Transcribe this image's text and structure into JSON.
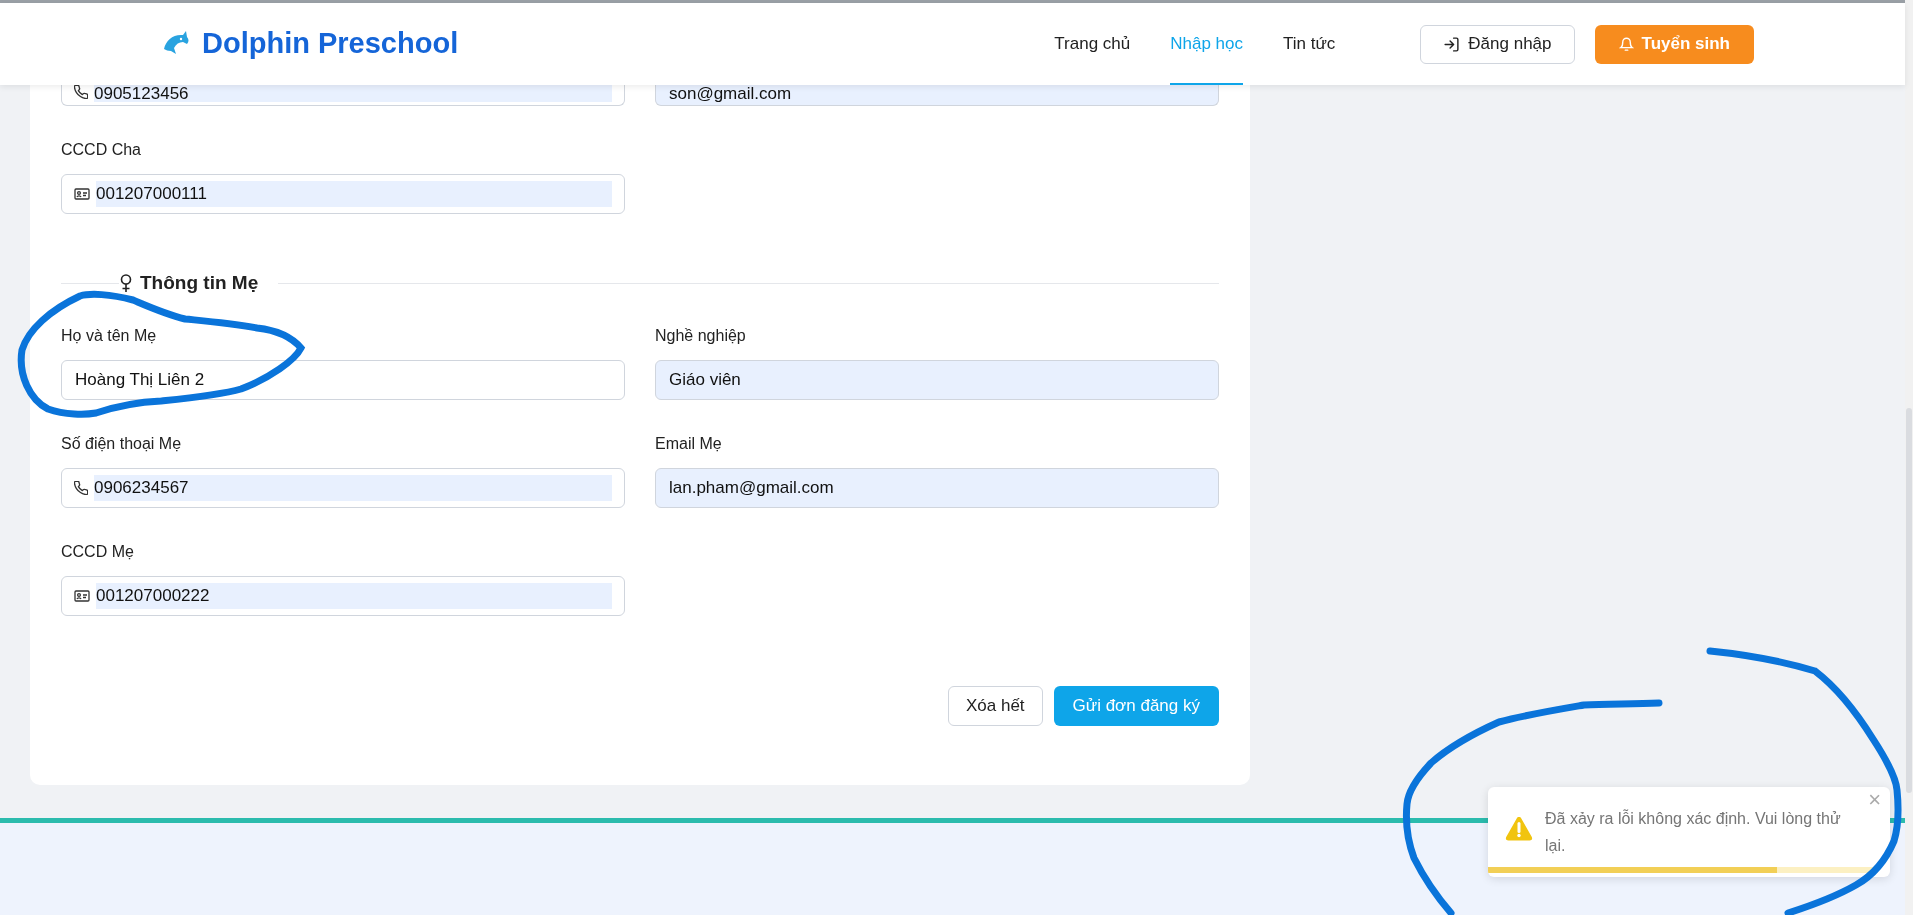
{
  "header": {
    "brand": "Dolphin Preschool",
    "nav": [
      {
        "label": "Trang chủ",
        "selected": false
      },
      {
        "label": "Nhập học",
        "selected": true
      },
      {
        "label": "Tin tức",
        "selected": false
      }
    ],
    "login_button": "Đăng nhập",
    "cta_button": "Tuyển sinh"
  },
  "father_rows": [
    [
      {
        "kind": "phone",
        "value": "0905123456",
        "autofilled": true
      },
      {
        "kind": "text",
        "value": "son@gmail.com",
        "autofilled": true
      }
    ],
    [
      {
        "label": "CCCD Cha",
        "kind": "id",
        "value": "001207000111",
        "autofilled": true
      }
    ]
  ],
  "mother_section": {
    "title": "Thông tin Mẹ",
    "rows": [
      [
        {
          "label": "Họ và tên Mẹ",
          "kind": "text",
          "value": "Hoàng Thị Liên 2",
          "autofilled": false
        },
        {
          "label": "Nghề nghiệp",
          "kind": "text",
          "value": "Giáo viên",
          "autofilled": true
        }
      ],
      [
        {
          "label": "Số điện thoại Mẹ",
          "kind": "phone",
          "value": "0906234567",
          "autofilled": true
        },
        {
          "label": "Email Mẹ",
          "kind": "text",
          "value": "lan.pham@gmail.com",
          "autofilled": true
        }
      ],
      [
        {
          "label": "CCCD Mẹ",
          "kind": "id",
          "value": "001207000222",
          "autofilled": true
        }
      ]
    ]
  },
  "actions": [
    {
      "label": "Xóa hết",
      "kind": "secondary"
    },
    {
      "label": "Gửi đơn đăng ký",
      "kind": "primary"
    }
  ],
  "toast": {
    "message": "Đã xảy ra lỗi không xác định. Vui lòng thử lại.",
    "close": "×",
    "level": 0.74
  }
}
